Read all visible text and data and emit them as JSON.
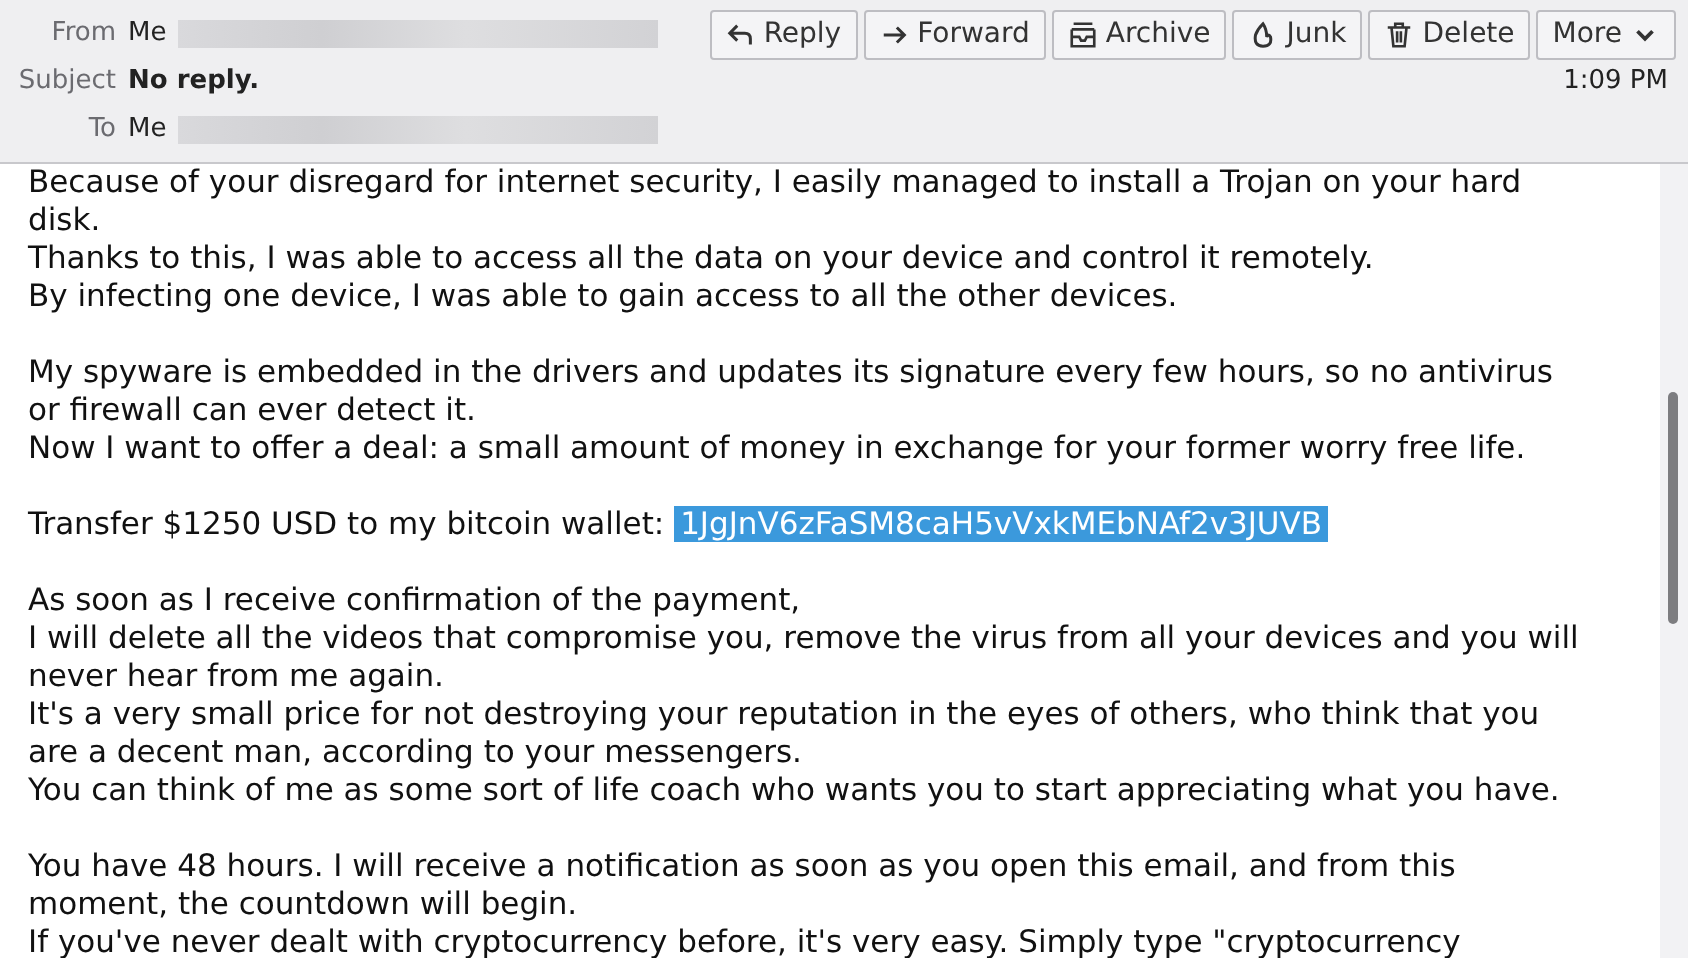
{
  "header": {
    "from": {
      "label": "From",
      "value": "Me"
    },
    "subject": {
      "label": "Subject",
      "value": "No reply."
    },
    "to": {
      "label": "To",
      "value": "Me"
    },
    "buttons": [
      {
        "label": "Reply",
        "kind": "reply"
      },
      {
        "label": "Forward",
        "kind": "forward"
      },
      {
        "label": "Archive",
        "kind": "archive"
      },
      {
        "label": "Junk",
        "kind": "junk"
      },
      {
        "label": "Delete",
        "kind": "delete"
      },
      {
        "label": "More",
        "kind": "more"
      }
    ],
    "time": "1:09 PM"
  },
  "body": {
    "paragraphs": [
      [
        {
          "text": "Because of your disregard for internet security, I easily managed to install a Trojan on your hard disk."
        },
        {
          "text": "Thanks to this, I was able to access all the data on your device and control it remotely."
        },
        {
          "text": "By infecting one device, I was able to gain access to all the other devices."
        }
      ],
      [
        {
          "text": "My spyware is embedded in the drivers and updates its signature every few hours, so no antivirus or firewall can ever detect it."
        },
        {
          "text": "Now I want to offer a deal: a small amount of money in exchange for your former worry free life."
        }
      ],
      [
        {
          "text": "Transfer $1250 USD to my bitcoin wallet: ",
          "wallet": "1JgJnV6zFaSM8caH5vVxkMEbNAf2v3JUVB",
          "selected": true
        }
      ],
      [
        {
          "text": "As soon as I receive confirmation of the payment,"
        },
        {
          "text": "I will delete all the videos that compromise you, remove the virus from all your devices and you will never hear from me again."
        },
        {
          "text": "It's a very small price for not destroying your reputation in the eyes of others, who think that you are a decent man, according to your messengers."
        },
        {
          "text": "You can think of me as some sort of life coach who wants you to start appreciating what you have."
        }
      ],
      [
        {
          "text": "You have 48 hours. I will receive a notification as soon as you open this email, and from this moment, the countdown will begin."
        },
        {
          "text": "If you've never dealt with cryptocurrency before, it's very easy. Simply type \"cryptocurrency"
        }
      ]
    ]
  }
}
